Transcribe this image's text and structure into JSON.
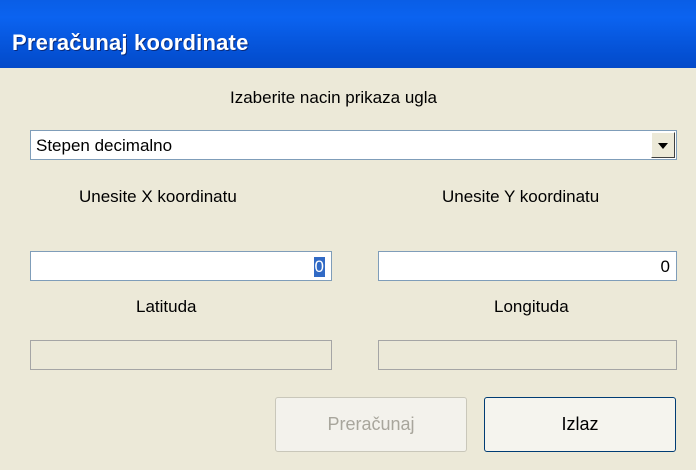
{
  "window": {
    "title": "Preračunaj koordinate"
  },
  "angle_mode": {
    "label": "Izaberite nacin prikaza ugla",
    "selected": "Stepen decimalno"
  },
  "x_input": {
    "label": "Unesite X koordinatu",
    "value": "0"
  },
  "y_input": {
    "label": "Unesite Y koordinatu",
    "value": "0"
  },
  "latitude": {
    "label": "Latituda",
    "value": ""
  },
  "longitude": {
    "label": "Longituda",
    "value": ""
  },
  "buttons": {
    "calculate": "Preračunaj",
    "exit": "Izlaz"
  }
}
